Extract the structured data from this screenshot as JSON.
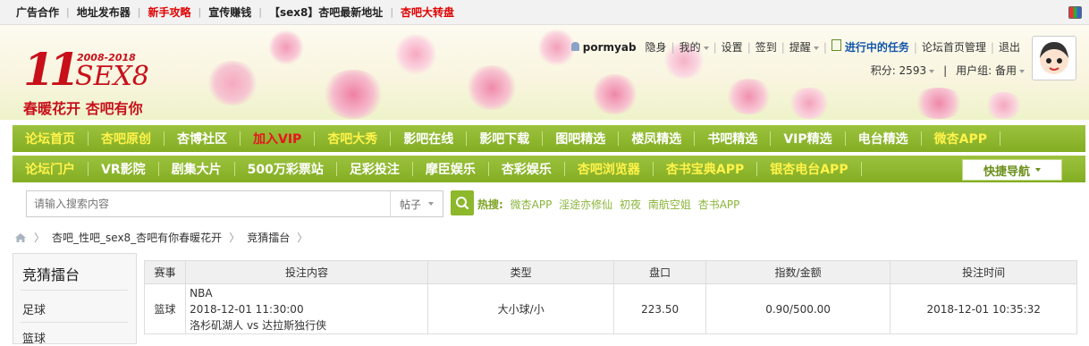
{
  "topbar": {
    "links": [
      {
        "label": "广告合作",
        "red": false
      },
      {
        "label": "地址发布器",
        "red": false
      },
      {
        "label": "新手攻略",
        "red": true
      },
      {
        "label": "宣传赚钱",
        "red": false
      },
      {
        "label": "【sex8】杏吧最新地址",
        "red": false
      },
      {
        "label": "杏吧大转盘",
        "red": true
      }
    ],
    "icon": "color-palette-icon"
  },
  "logo": {
    "number": "11",
    "years": "2008-2018",
    "brand": "SEX8",
    "slogan": "春暖花开 杏吧有你"
  },
  "user": {
    "username": "pormyab",
    "stealth": "隐身",
    "mine": "我的",
    "settings": "设置",
    "checkin": "签到",
    "remind": "提醒",
    "tasks": "进行中的任务",
    "forum_admin": "论坛首页管理",
    "logout": "退出",
    "points": "积分: 2593",
    "group": "用户组: 备用"
  },
  "nav1": [
    {
      "label": "论坛首页",
      "color": "y"
    },
    {
      "label": "杏吧原创",
      "color": "y"
    },
    {
      "label": "杏博社区",
      "color": ""
    },
    {
      "label": "加入VIP",
      "color": "r"
    },
    {
      "label": "杏吧大秀",
      "color": "y"
    },
    {
      "label": "影吧在线",
      "color": ""
    },
    {
      "label": "影吧下载",
      "color": ""
    },
    {
      "label": "图吧精选",
      "color": ""
    },
    {
      "label": "楼凤精选",
      "color": ""
    },
    {
      "label": "书吧精选",
      "color": ""
    },
    {
      "label": "VIP精选",
      "color": ""
    },
    {
      "label": "电台精选",
      "color": ""
    },
    {
      "label": "微杏APP",
      "color": "y"
    }
  ],
  "nav2": [
    {
      "label": "论坛门户",
      "color": "y"
    },
    {
      "label": "VR影院",
      "color": ""
    },
    {
      "label": "剧集大片",
      "color": ""
    },
    {
      "label": "500万彩票站",
      "color": ""
    },
    {
      "label": "足彩投注",
      "color": ""
    },
    {
      "label": "摩臣娱乐",
      "color": ""
    },
    {
      "label": "杏彩娱乐",
      "color": ""
    },
    {
      "label": "杏吧浏览器",
      "color": "y"
    },
    {
      "label": "杏书宝典APP",
      "color": "y"
    },
    {
      "label": "银杏电台APP",
      "color": "y"
    }
  ],
  "quicknav": "快捷导航",
  "search": {
    "placeholder": "请输入搜索内容",
    "type": "帖子",
    "hot_label": "热搜:",
    "hot_words": [
      "微杏APP",
      "淫途亦修仙",
      "初夜",
      "南航空姐",
      "杏书APP"
    ]
  },
  "breadcrumb": [
    "杏吧_性吧_sex8_杏吧有你春暖花开",
    "竞猜擂台"
  ],
  "sidebar": {
    "title": "竞猜擂台",
    "items": [
      "足球",
      "篮球"
    ]
  },
  "table": {
    "headers": [
      "赛事",
      "投注内容",
      "类型",
      "盘口",
      "指数/金额",
      "投注时间"
    ],
    "rows": [
      {
        "event": "篮球",
        "league": "NBA",
        "match_time": "2018-12-01 11:30:00",
        "teams": "洛杉矶湖人 vs 达拉斯独行侠",
        "type": "大小球/小",
        "handicap": "223.50",
        "odds_amount": "0.90/500.00",
        "bet_time": "2018-12-01 10:35:32"
      }
    ]
  },
  "colors": {
    "nav_green": "#8db82c",
    "brand_red": "#c8101a",
    "nav_yellow": "#fff34a",
    "nav_red": "#e8141e"
  }
}
